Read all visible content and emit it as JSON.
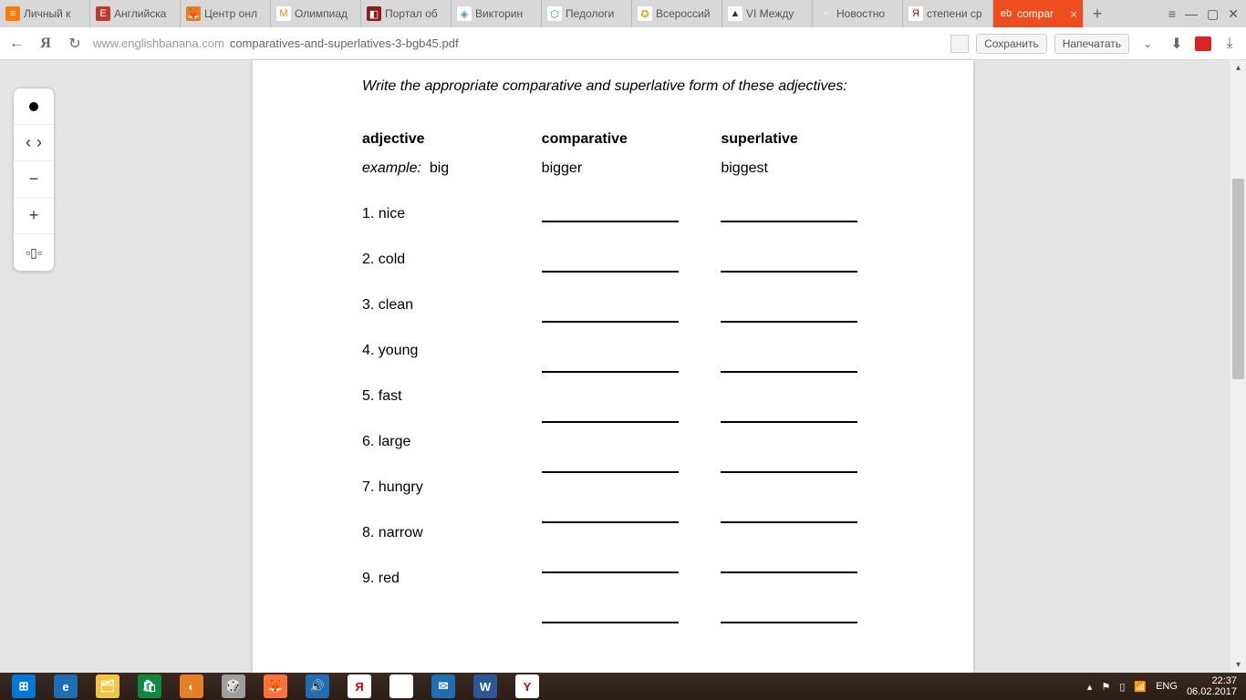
{
  "tabs": [
    {
      "label": "Личный к",
      "iconBg": "#ff7a00",
      "iconChar": "≡"
    },
    {
      "label": "Английска",
      "iconBg": "#c0392b",
      "iconChar": "E"
    },
    {
      "label": "Центр онл",
      "iconBg": "#e67e22",
      "iconChar": "🦊"
    },
    {
      "label": "Олимпиад",
      "iconBg": "#fff",
      "iconChar": "M",
      "iconColor": "#e38b00"
    },
    {
      "label": "Портал об",
      "iconBg": "#8e1b1b",
      "iconChar": "◧"
    },
    {
      "label": "Викторин",
      "iconBg": "#fff",
      "iconChar": "◈",
      "iconColor": "#2aa0c8"
    },
    {
      "label": "Педологи",
      "iconBg": "#fff",
      "iconChar": "⬡",
      "iconColor": "#2fa84f"
    },
    {
      "label": "Всероссий",
      "iconBg": "#fff",
      "iconChar": "✪",
      "iconColor": "#d9a400"
    },
    {
      "label": "VI Между",
      "iconBg": "#fff",
      "iconChar": "▲",
      "iconColor": "#15356b"
    },
    {
      "label": "Новостно",
      "iconBg": "#d9d9d9",
      "iconChar": "▫"
    },
    {
      "label": "степени ср",
      "iconBg": "#fff",
      "iconChar": "Я",
      "iconColor": "#d00"
    },
    {
      "label": "compar",
      "iconBg": "#ec4e20",
      "iconChar": "eb",
      "active": true
    }
  ],
  "url": {
    "host": "www.englishbanana.com",
    "path": "comparatives-and-superlatives-3-bgb45.pdf"
  },
  "btns": {
    "save": "Сохранить",
    "print": "Напечатать"
  },
  "doc": {
    "instr": "Write the appropriate comparative and superlative form of these adjectives:",
    "h1": "adjective",
    "h2": "comparative",
    "h3": "superlative",
    "exLabel": "example:",
    "exAdj": "big",
    "exComp": "bigger",
    "exSup": "biggest",
    "items": [
      "1. nice",
      "2. cold",
      "3. clean",
      "4. young",
      "5. fast",
      "6. large",
      "7. hungry",
      "8. narrow",
      "9. red"
    ]
  },
  "tray": {
    "lang": "ENG",
    "time": "22:37",
    "date": "06.02.2017"
  }
}
